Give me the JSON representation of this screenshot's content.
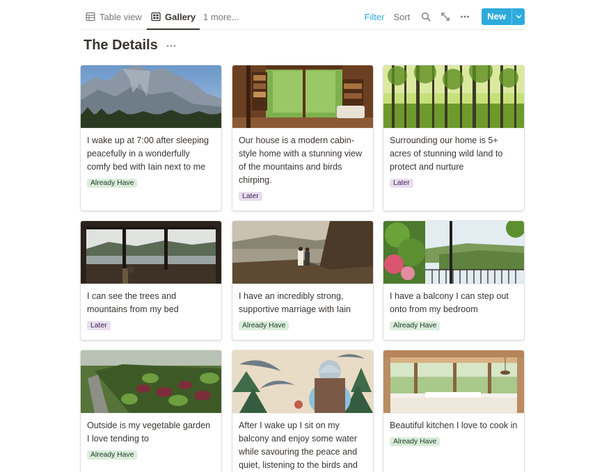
{
  "toolbar": {
    "tabs": [
      {
        "label": "Table view",
        "icon": "table-icon"
      },
      {
        "label": "Gallery",
        "icon": "gallery-icon"
      },
      {
        "label": "1 more..."
      }
    ],
    "filter_label": "Filter",
    "sort_label": "Sort",
    "new_label": "New",
    "accent_color": "#2eaadc"
  },
  "database": {
    "title": "The Details"
  },
  "cards": [
    {
      "text": "I wake up at 7:00 after sleeping peacefully in a wonderfully comfy bed with Iain next to me",
      "tag": "Already Have",
      "image": "mountain-range-photo"
    },
    {
      "text": "Our house is a modern cabin-style home with a stunning view of the mountains and birds chirping.",
      "tag": "Later",
      "image": "cabin-interior-photo"
    },
    {
      "text": "Surrounding our home is 5+ acres of stunning wild land to protect and nurture",
      "tag": "Later",
      "image": "forest-photo"
    },
    {
      "text": "I can see the trees and mountains from my bed",
      "tag": "Later",
      "image": "lake-window-view-photo"
    },
    {
      "text": "I have an incredibly strong, supportive marriage with Iain",
      "tag": "Already Have",
      "image": "couple-by-lake-photo"
    },
    {
      "text": "I have a balcony I can step out onto from my bedroom",
      "tag": "Already Have",
      "image": "balcony-garden-photo"
    },
    {
      "text": "Outside is my vegetable garden I love tending to",
      "tag": "Already Have",
      "image": "vegetable-garden-photo"
    },
    {
      "text": "After I wake up I sit on my balcony and enjoy some water while savouring the peace and quiet, listening to the birds and",
      "tag": "",
      "image": "birds-illustration"
    },
    {
      "text": "Beautiful kitchen I love to cook in",
      "tag": "Already Have",
      "image": "kitchen-photo"
    }
  ],
  "tag_colors": {
    "Already Have": {
      "bg": "#dbeddb",
      "fg": "#1c3829"
    },
    "Later": {
      "bg": "#e8deee",
      "fg": "#412454"
    }
  }
}
